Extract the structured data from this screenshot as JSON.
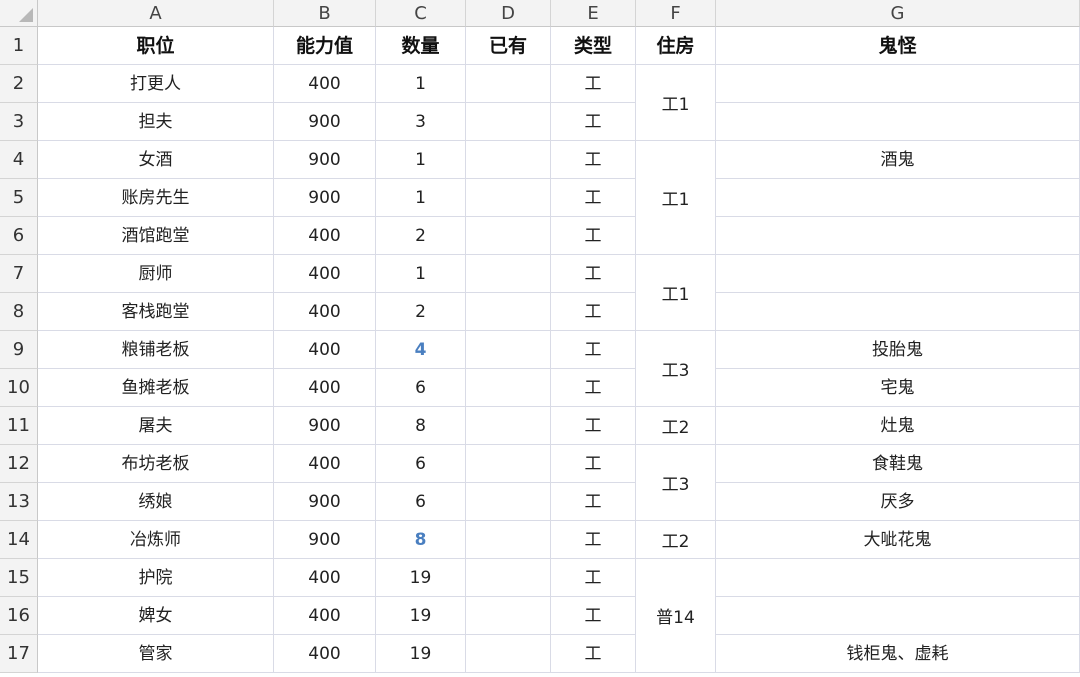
{
  "columns": [
    "A",
    "B",
    "C",
    "D",
    "E",
    "F",
    "G"
  ],
  "header": {
    "a": "职位",
    "b": "能力值",
    "c": "数量",
    "d": "已有",
    "e": "类型",
    "f": "住房",
    "g": "鬼怪"
  },
  "rows": [
    {
      "num": "1"
    },
    {
      "num": "2",
      "a": "打更人",
      "b": "400",
      "c": "1",
      "d": "",
      "e": "工",
      "g": ""
    },
    {
      "num": "3",
      "a": "担夫",
      "b": "900",
      "c": "3",
      "d": "",
      "e": "工",
      "g": ""
    },
    {
      "num": "4",
      "a": "女酒",
      "b": "900",
      "c": "1",
      "d": "",
      "e": "工",
      "g": "酒鬼"
    },
    {
      "num": "5",
      "a": "账房先生",
      "b": "900",
      "c": "1",
      "d": "",
      "e": "工",
      "g": ""
    },
    {
      "num": "6",
      "a": "酒馆跑堂",
      "b": "400",
      "c": "2",
      "d": "",
      "e": "工",
      "g": ""
    },
    {
      "num": "7",
      "a": "厨师",
      "b": "400",
      "c": "1",
      "d": "",
      "e": "工",
      "g": ""
    },
    {
      "num": "8",
      "a": "客栈跑堂",
      "b": "400",
      "c": "2",
      "d": "",
      "e": "工",
      "g": ""
    },
    {
      "num": "9",
      "a": "粮铺老板",
      "b": "400",
      "c": "4",
      "d": "",
      "e": "工",
      "g": "投胎鬼"
    },
    {
      "num": "10",
      "a": "鱼摊老板",
      "b": "400",
      "c": "6",
      "d": "",
      "e": "工",
      "g": "宅鬼"
    },
    {
      "num": "11",
      "a": "屠夫",
      "b": "900",
      "c": "8",
      "d": "",
      "e": "工",
      "g": "灶鬼"
    },
    {
      "num": "12",
      "a": "布坊老板",
      "b": "400",
      "c": "6",
      "d": "",
      "e": "工",
      "g": "食鞋鬼"
    },
    {
      "num": "13",
      "a": "绣娘",
      "b": "900",
      "c": "6",
      "d": "",
      "e": "工",
      "g": "厌多"
    },
    {
      "num": "14",
      "a": "冶炼师",
      "b": "900",
      "c": "8",
      "d": "",
      "e": "工",
      "g": "大呲花鬼"
    },
    {
      "num": "15",
      "a": "护院",
      "b": "400",
      "c": "19",
      "d": "",
      "e": "工",
      "g": ""
    },
    {
      "num": "16",
      "a": "婢女",
      "b": "400",
      "c": "19",
      "d": "",
      "e": "工",
      "g": ""
    },
    {
      "num": "17",
      "a": "管家",
      "b": "400",
      "c": "19",
      "d": "",
      "e": "工",
      "g": "钱柜鬼、虚耗"
    }
  ],
  "housing": [
    {
      "label": "工1"
    },
    {
      "label": "工1"
    },
    {
      "label": "工1"
    },
    {
      "label": "工3"
    },
    {
      "label": "工2"
    },
    {
      "label": "工3"
    },
    {
      "label": "工2"
    },
    {
      "label": "普14"
    }
  ],
  "highlight_color": "#4a7fc0"
}
